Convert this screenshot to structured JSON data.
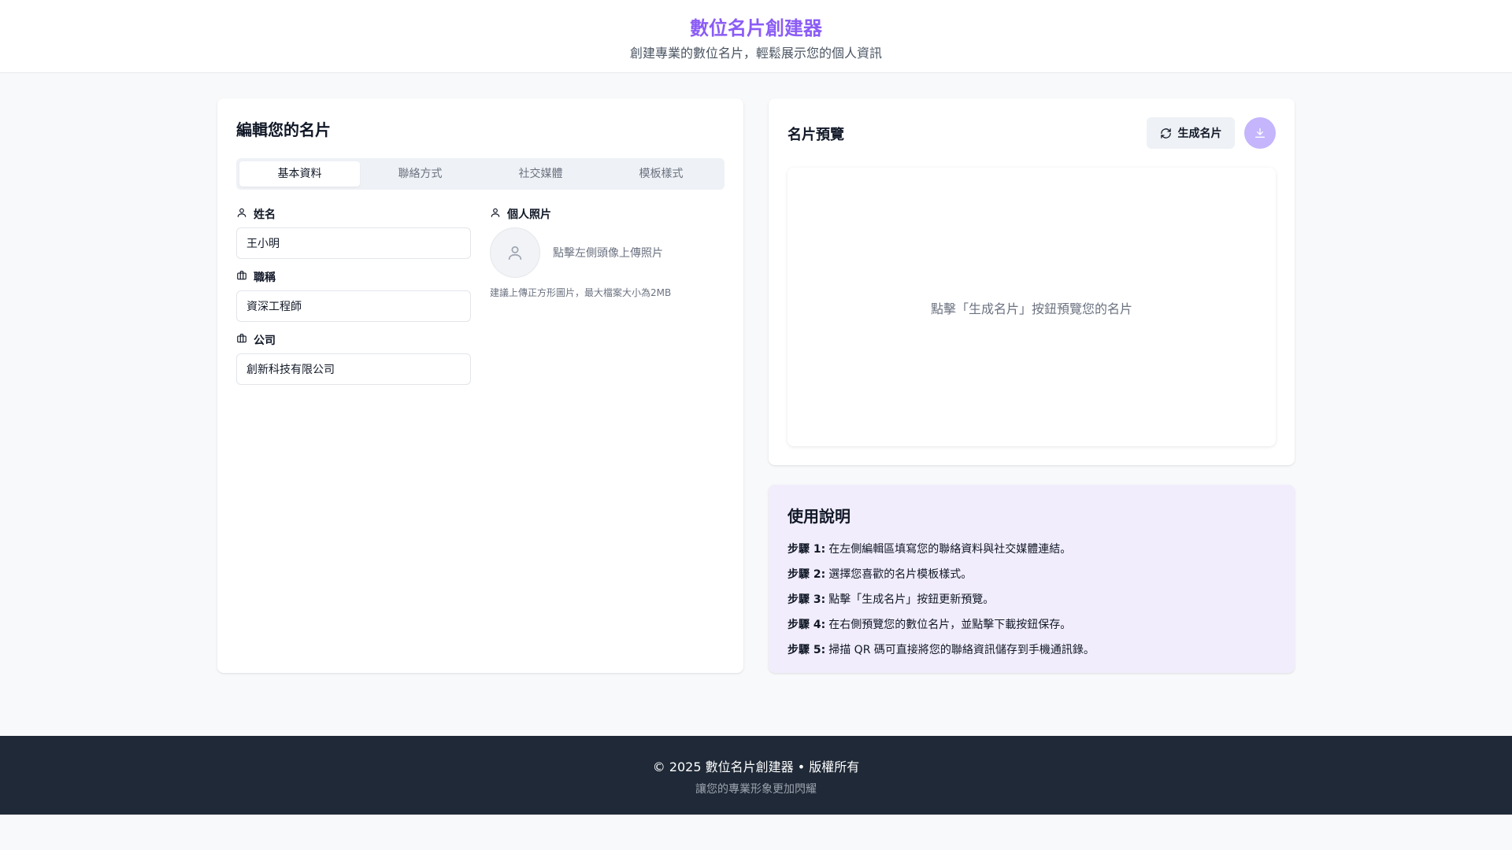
{
  "header": {
    "title": "數位名片創建器",
    "subtitle": "創建專業的數位名片，輕鬆展示您的個人資訊"
  },
  "editor": {
    "title": "編輯您的名片",
    "tabs": [
      {
        "label": "基本資料",
        "active": true
      },
      {
        "label": "聯絡方式",
        "active": false
      },
      {
        "label": "社交媒體",
        "active": false
      },
      {
        "label": "模板樣式",
        "active": false
      }
    ],
    "fields": {
      "name": {
        "label": "姓名",
        "value": "王小明",
        "icon": "user-icon"
      },
      "job_title": {
        "label": "職稱",
        "value": "資深工程師",
        "icon": "briefcase-icon"
      },
      "company": {
        "label": "公司",
        "value": "創新科技有限公司",
        "icon": "briefcase-icon"
      }
    },
    "photo": {
      "label": "個人照片",
      "hint": "點擊左側頭像上傳照片",
      "note": "建議上傳正方形圖片，最大檔案大小為2MB"
    }
  },
  "preview": {
    "title": "名片預覽",
    "generate_label": "生成名片",
    "placeholder": "點擊「生成名片」按鈕預覽您的名片"
  },
  "guide": {
    "title": "使用說明",
    "steps": [
      {
        "prefix": "步驟 1:",
        "text": "在左側編輯區填寫您的聯絡資料與社交媒體連結。"
      },
      {
        "prefix": "步驟 2:",
        "text": "選擇您喜歡的名片模板樣式。"
      },
      {
        "prefix": "步驟 3:",
        "text": "點擊「生成名片」按鈕更新預覽。"
      },
      {
        "prefix": "步驟 4:",
        "text": "在右側預覽您的數位名片，並點擊下載按鈕保存。"
      },
      {
        "prefix": "步驟 5:",
        "text": "掃描 QR 碼可直接將您的聯絡資訊儲存到手機通訊錄。"
      }
    ]
  },
  "footer": {
    "copyright": "© 2025 數位名片創建器 • 版權所有",
    "tagline": "讓您的專業形象更加閃耀"
  },
  "colors": {
    "accent": "#8b5cf6",
    "download_button": "#c4b5fd",
    "guide_background": "#f1edfc",
    "footer_background": "#1f2937"
  }
}
